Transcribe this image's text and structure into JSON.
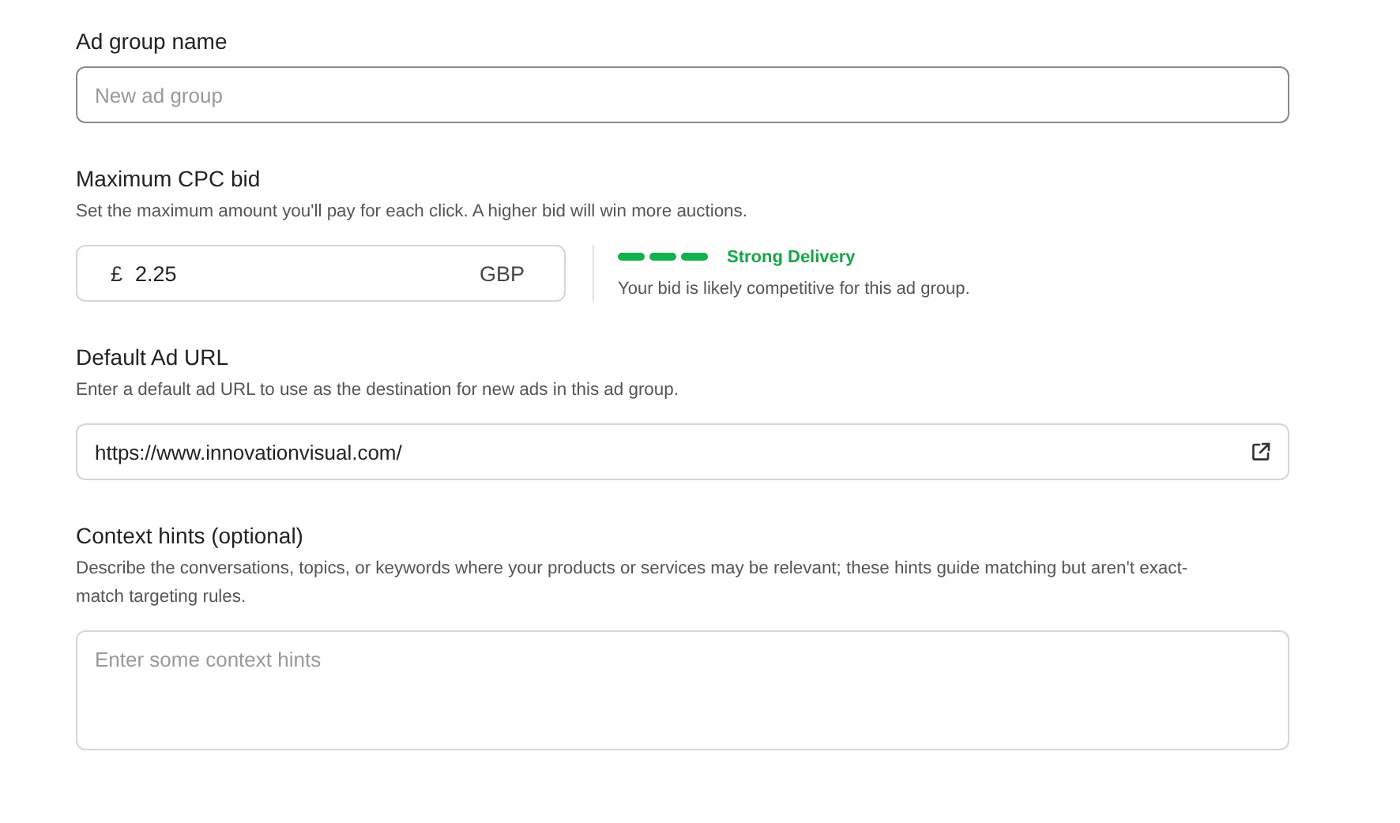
{
  "ad_group_name": {
    "label": "Ad group name",
    "placeholder": "New ad group",
    "focused": true
  },
  "max_cpc_bid": {
    "label": "Maximum CPC bid",
    "description": "Set the maximum amount you'll pay for each click. A higher bid will win more auctions.",
    "currency_symbol": "£",
    "value": "2.25",
    "currency": "GBP",
    "delivery": {
      "label": "Strong Delivery",
      "note": "Your bid is likely competitive for this ad group."
    }
  },
  "default_ad_url": {
    "label": "Default Ad URL",
    "description": "Enter a default ad URL to use as the destination for new ads in this ad group.",
    "value": "https://www.innovationvisual.com/"
  },
  "context_hints": {
    "label": "Context hints (optional)",
    "description": "Describe the conversations, topics, or keywords where your products or services may be relevant; these hints guide matching but aren't exact-match targeting rules.",
    "placeholder": "Enter some context hints"
  }
}
